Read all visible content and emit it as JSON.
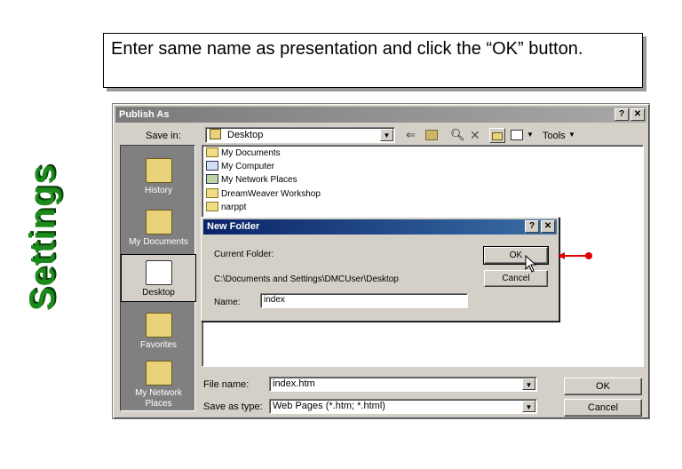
{
  "callout": {
    "text": "Enter same name as presentation and click the “OK” button."
  },
  "side_label": "Settings",
  "window": {
    "title": "Publish As",
    "help_button": "?",
    "close_button": "✕",
    "save_in_label": "Save in:",
    "save_in_value": "Desktop",
    "tools_label": "Tools",
    "places": [
      {
        "label": "History"
      },
      {
        "label": "My Documents"
      },
      {
        "label": "Desktop"
      },
      {
        "label": "Favorites"
      },
      {
        "label": "My Network Places"
      }
    ],
    "files": [
      "My Documents",
      "My Computer",
      "My Network Places",
      "DreamWeaver Workshop",
      "narppt"
    ],
    "file_name_label": "File name:",
    "file_name_value": "index.htm",
    "save_as_type_label": "Save as type:",
    "save_as_type_value": "Web Pages (*.htm; *.html)",
    "ok_label": "OK",
    "cancel_label": "Cancel"
  },
  "new_folder": {
    "title": "New Folder",
    "current_folder_label": "Current Folder:",
    "current_folder_path": "C:\\Documents and Settings\\DMCUser\\Desktop",
    "name_label": "Name:",
    "name_value": "index",
    "ok_label": "OK",
    "cancel_label": "Cancel"
  },
  "colors": {
    "settings_green": "#1a8a1a",
    "arrow_red": "#e00000"
  }
}
